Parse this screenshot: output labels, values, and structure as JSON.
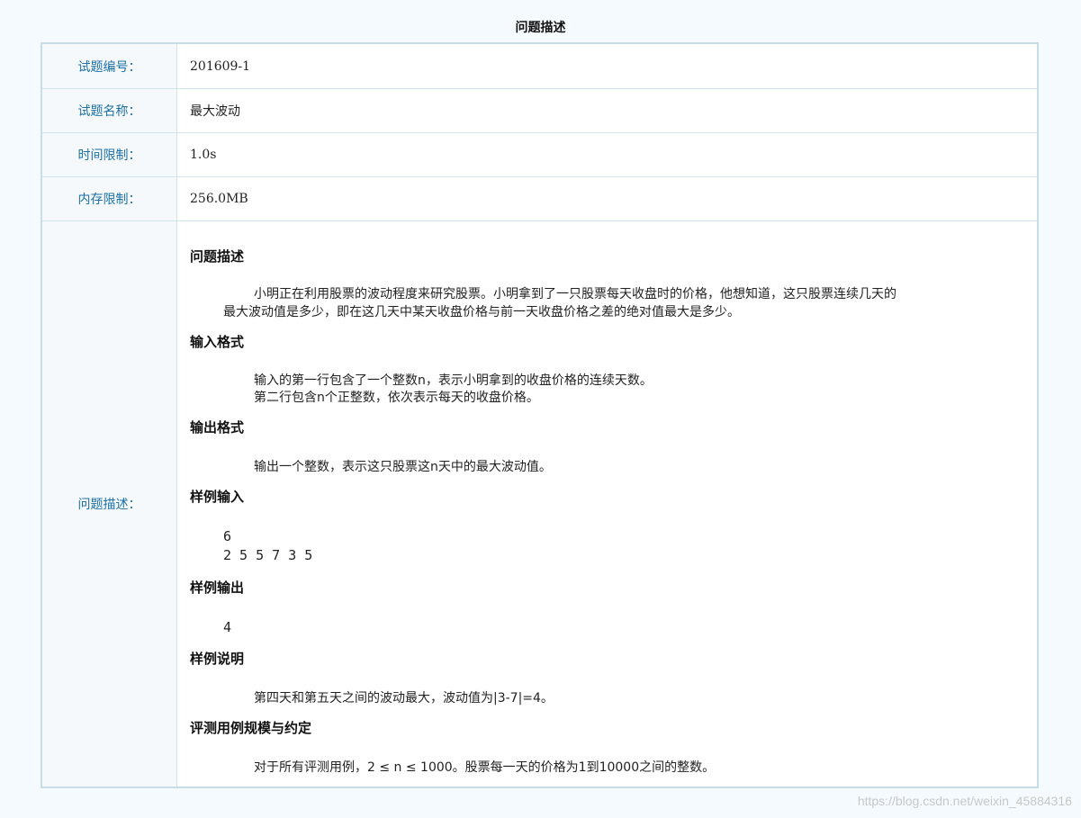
{
  "header": {
    "title": "问题描述"
  },
  "rows": [
    {
      "label": "试题编号：",
      "value": "201609-1"
    },
    {
      "label": "试题名称：",
      "value": "最大波动"
    },
    {
      "label": "时间限制：",
      "value": "1.0s"
    },
    {
      "label": "内存限制：",
      "value": "256.0MB"
    }
  ],
  "description": {
    "label": "问题描述：",
    "sections": {
      "problem": {
        "heading": "问题描述",
        "line1": "小明正在利用股票的波动程度来研究股票。小明拿到了一只股票每天收盘时的价格，他想知道，这只股票连续几天的",
        "line2": "最大波动值是多少，即在这几天中某天收盘价格与前一天收盘价格之差的绝对值最大是多少。"
      },
      "input": {
        "heading": "输入格式",
        "line1": "输入的第一行包含了一个整数n，表示小明拿到的收盘价格的连续天数。",
        "line2": "第二行包含n个正整数，依次表示每天的收盘价格。"
      },
      "output": {
        "heading": "输出格式",
        "line1": "输出一个整数，表示这只股票这n天中的最大波动值。"
      },
      "sample_input": {
        "heading": "样例输入",
        "line1": "6",
        "line2": "2 5 5 7 3 5"
      },
      "sample_output": {
        "heading": "样例输出",
        "line1": "4"
      },
      "sample_explain": {
        "heading": "样例说明",
        "line1": "第四天和第五天之间的波动最大，波动值为|3-7|=4。"
      },
      "constraints": {
        "heading": "评测用例规模与约定",
        "line1": "对于所有评测用例，2 ≤ n ≤ 1000。股票每一天的价格为1到10000之间的整数。"
      }
    }
  },
  "watermark": "https://blog.csdn.net/weixin_45884316"
}
